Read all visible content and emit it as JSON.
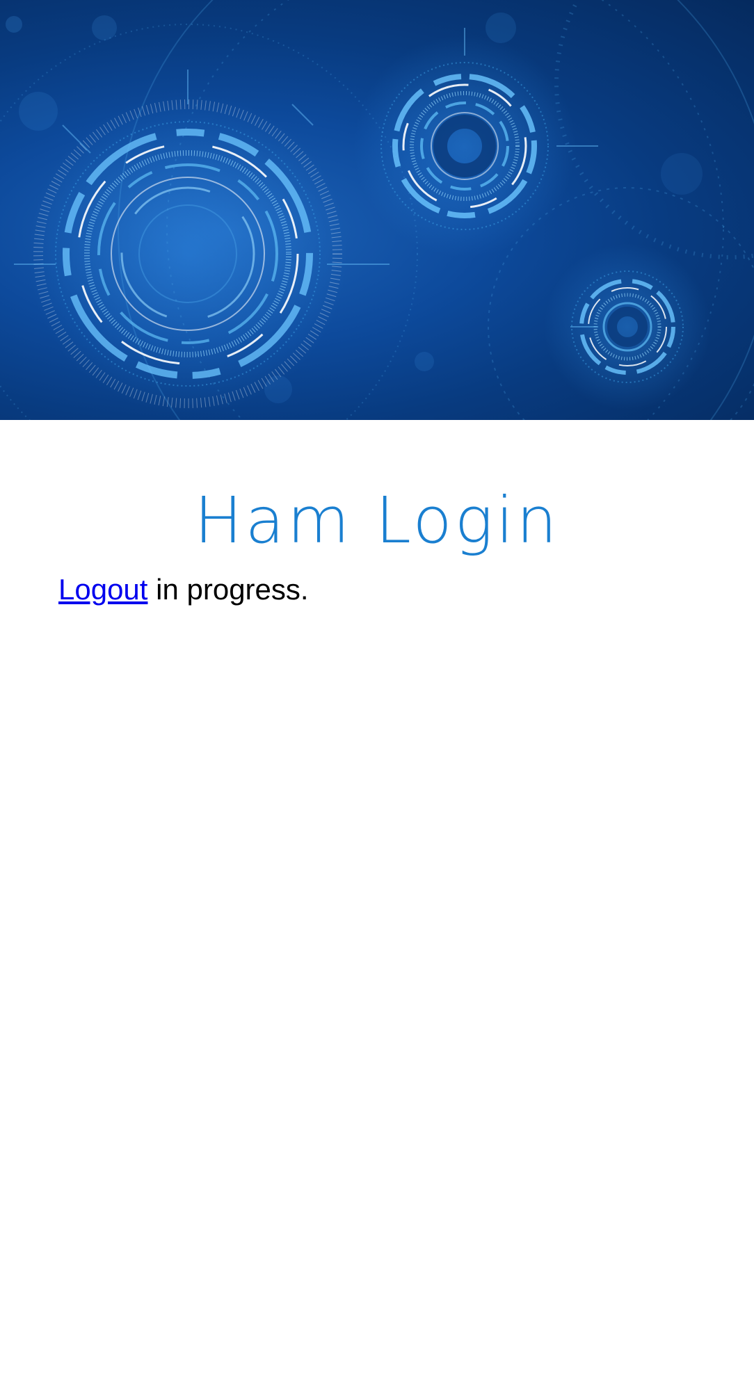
{
  "banner": {
    "image_icon": "tech-circles-banner-image",
    "colors": {
      "background_dark": "#052a5e",
      "background_mid": "#0d4a9c",
      "ring_light": "#7fd4ff",
      "ring_white": "#ffffff"
    }
  },
  "header": {
    "title": "Ham Login",
    "title_color": "#1a7fd0"
  },
  "status": {
    "link_label": "Logout",
    "message": " in progress.",
    "link_color": "#0000ee"
  }
}
